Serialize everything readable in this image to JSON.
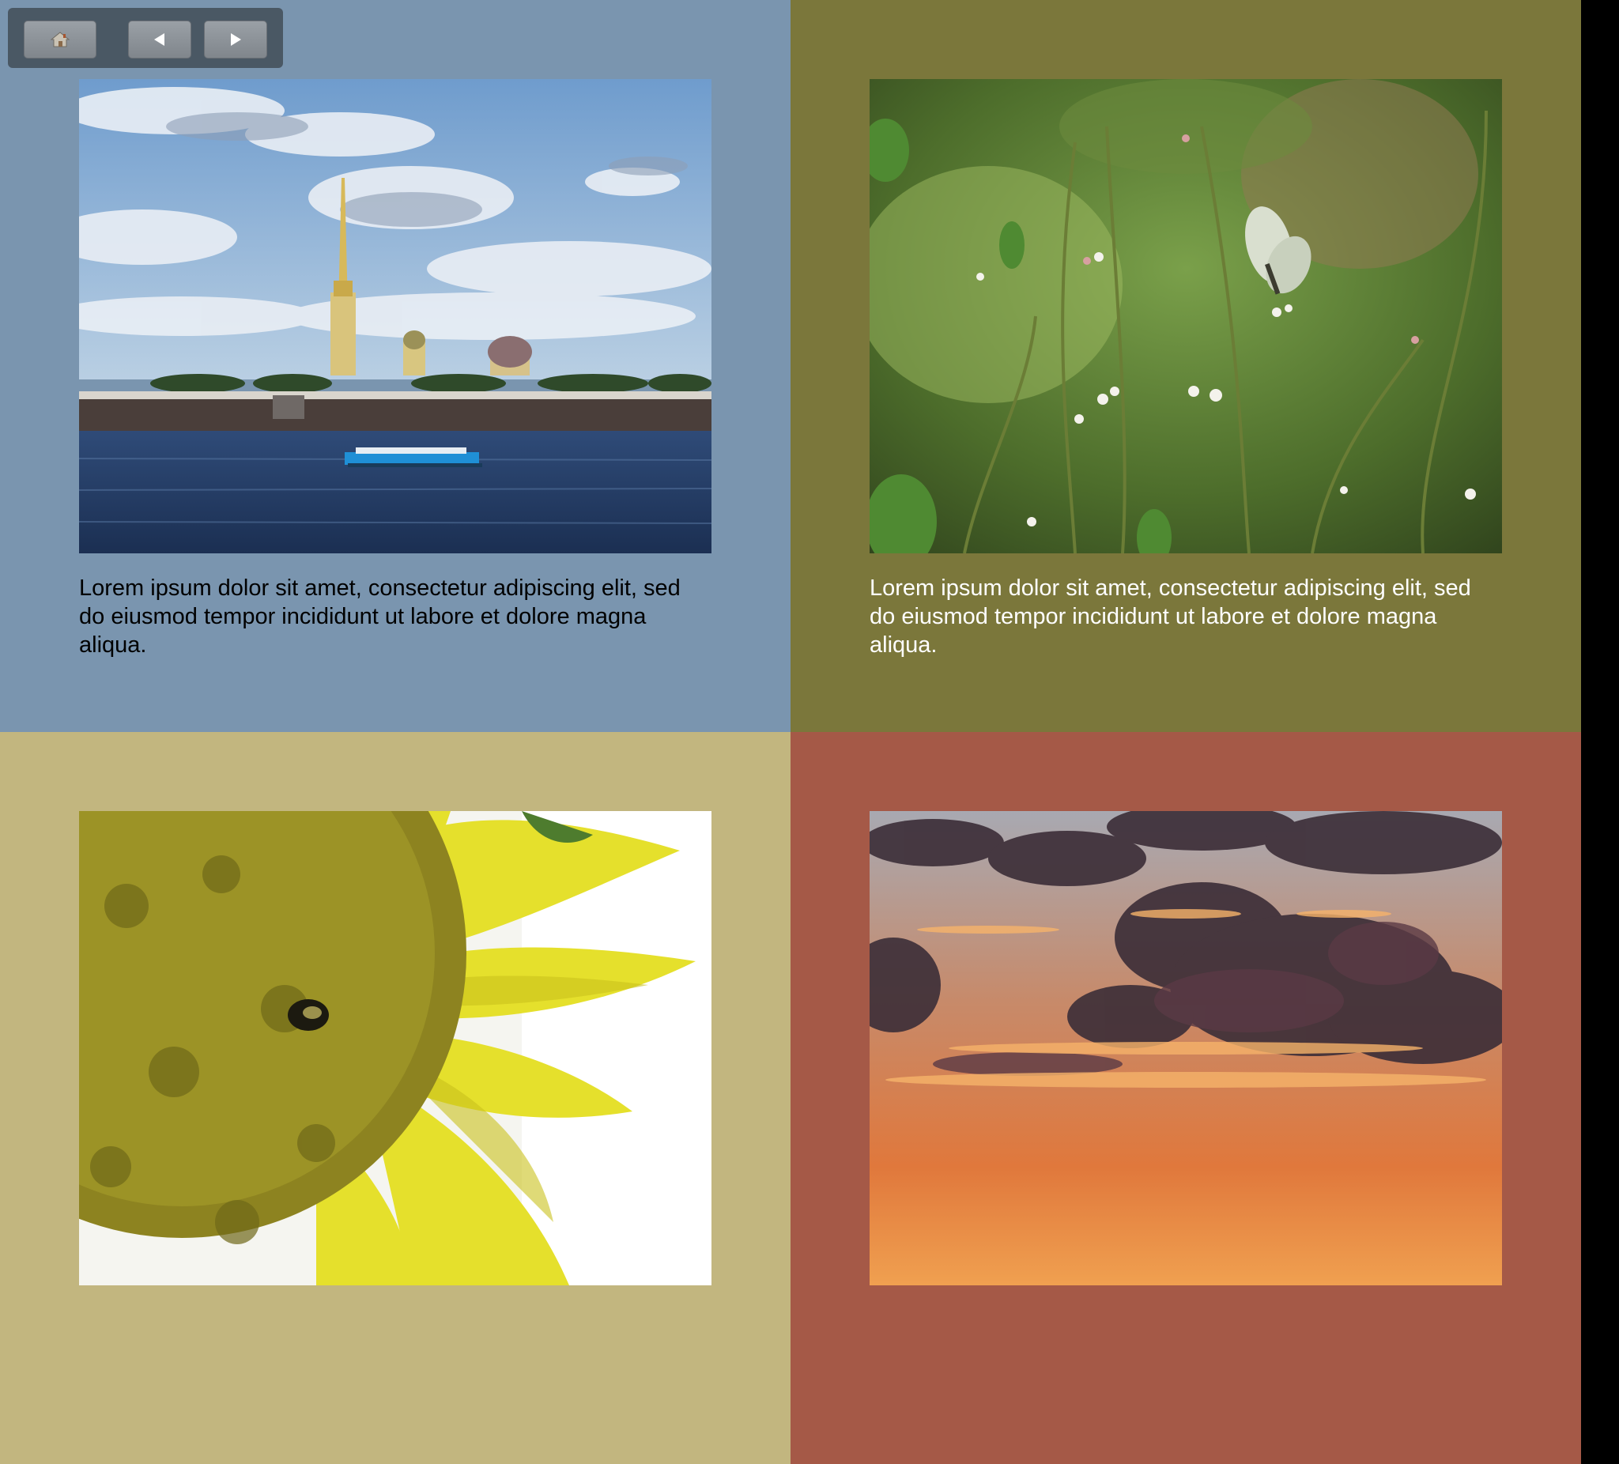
{
  "toolbar": {
    "buttons": [
      {
        "name": "home",
        "icon": "home-icon"
      },
      {
        "name": "previous",
        "icon": "arrow-left-icon"
      },
      {
        "name": "next",
        "icon": "arrow-right-icon"
      }
    ]
  },
  "tiles": [
    {
      "background": "#7a95af",
      "text_color": "#000000",
      "photo": "st-petersburg-fortress-river",
      "caption": "Lorem ipsum dolor sit amet, consectetur adipiscing elit, sed do eiusmod tempor incididunt ut labore et dolore magna aliqua."
    },
    {
      "background": "#7b773b",
      "text_color": "#ffffff",
      "photo": "butterfly-on-wildflowers",
      "caption": "Lorem ipsum dolor sit amet, consectetur adipiscing elit, sed do eiusmod tempor incididunt ut labore et dolore magna aliqua."
    },
    {
      "background": "#c2b67f",
      "text_color": "#000000",
      "photo": "sunflower-with-bee",
      "caption": ""
    },
    {
      "background": "#a55947",
      "text_color": "#ffffff",
      "photo": "sunset-clouds",
      "caption": ""
    }
  ]
}
